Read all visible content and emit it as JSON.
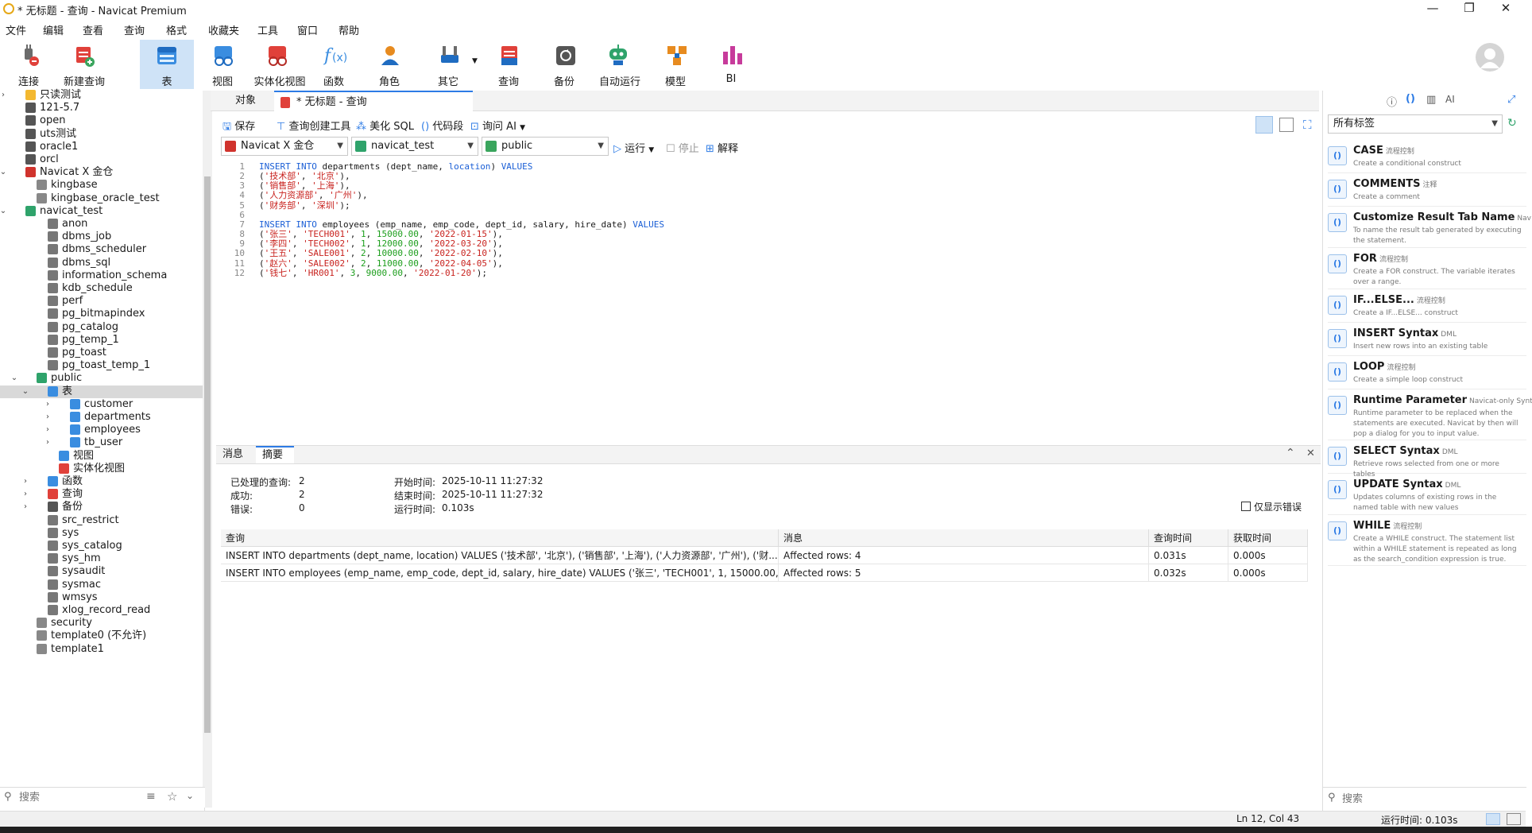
{
  "window": {
    "title": "* 无标题 - 查询 - Navicat Premium",
    "minimize": "—",
    "maximize": "❐",
    "close": "✕"
  },
  "menu": [
    "文件",
    "编辑",
    "查看",
    "查询",
    "格式",
    "收藏夹",
    "工具",
    "窗口",
    "帮助"
  ],
  "toolbar": [
    {
      "label": "连接",
      "icon": "connect-plug-icon"
    },
    {
      "label": "新建查询",
      "icon": "new-query-icon"
    },
    {
      "label": "表",
      "icon": "table-icon"
    },
    {
      "label": "视图",
      "icon": "view-icon"
    },
    {
      "label": "实体化视图",
      "icon": "materialized-view-icon"
    },
    {
      "label": "函数",
      "icon": "function-icon"
    },
    {
      "label": "角色",
      "icon": "role-icon"
    },
    {
      "label": "其它",
      "icon": "other-tools-icon"
    },
    {
      "label": "查询",
      "icon": "query-icon"
    },
    {
      "label": "备份",
      "icon": "backup-icon"
    },
    {
      "label": "自动运行",
      "icon": "automation-robot-icon"
    },
    {
      "label": "模型",
      "icon": "model-icon"
    },
    {
      "label": "BI",
      "icon": "bi-chart-icon"
    }
  ],
  "tree": [
    {
      "label": "只读测试",
      "type": "folder"
    },
    {
      "label": "121-5.7",
      "type": "conn"
    },
    {
      "label": "open",
      "type": "conn"
    },
    {
      "label": "uts测试",
      "type": "conn"
    },
    {
      "label": "oracle1",
      "type": "conn"
    },
    {
      "label": "orcl",
      "type": "conn"
    },
    {
      "label": "Navicat X 金仓",
      "type": "kingbase"
    },
    {
      "label": "kingbase",
      "type": "db"
    },
    {
      "label": "kingbase_oracle_test",
      "type": "db"
    },
    {
      "label": "navicat_test",
      "type": "dbopen"
    },
    {
      "label": "anon",
      "type": "schema"
    },
    {
      "label": "dbms_job",
      "type": "schema"
    },
    {
      "label": "dbms_scheduler",
      "type": "schema"
    },
    {
      "label": "dbms_sql",
      "type": "schema"
    },
    {
      "label": "information_schema",
      "type": "schema"
    },
    {
      "label": "kdb_schedule",
      "type": "schema"
    },
    {
      "label": "perf",
      "type": "schema"
    },
    {
      "label": "pg_bitmapindex",
      "type": "schema"
    },
    {
      "label": "pg_catalog",
      "type": "schema"
    },
    {
      "label": "pg_temp_1",
      "type": "schema"
    },
    {
      "label": "pg_toast",
      "type": "schema"
    },
    {
      "label": "pg_toast_temp_1",
      "type": "schema"
    },
    {
      "label": "public",
      "type": "schemaopen"
    },
    {
      "label": "表",
      "type": "tables"
    },
    {
      "label": "customer",
      "type": "table"
    },
    {
      "label": "departments",
      "type": "table"
    },
    {
      "label": "employees",
      "type": "table"
    },
    {
      "label": "tb_user",
      "type": "table"
    },
    {
      "label": "视图",
      "type": "views"
    },
    {
      "label": "实体化视图",
      "type": "mviews"
    },
    {
      "label": "函数",
      "type": "funcs"
    },
    {
      "label": "查询",
      "type": "queries"
    },
    {
      "label": "备份",
      "type": "backups"
    },
    {
      "label": "src_restrict",
      "type": "schema"
    },
    {
      "label": "sys",
      "type": "schema"
    },
    {
      "label": "sys_catalog",
      "type": "schema"
    },
    {
      "label": "sys_hm",
      "type": "schema"
    },
    {
      "label": "sysaudit",
      "type": "schema"
    },
    {
      "label": "sysmac",
      "type": "schema"
    },
    {
      "label": "wmsys",
      "type": "schema"
    },
    {
      "label": "xlog_record_read",
      "type": "schema"
    },
    {
      "label": "security",
      "type": "db"
    },
    {
      "label": "template0 (不允许)",
      "type": "db"
    },
    {
      "label": "template1",
      "type": "db"
    }
  ],
  "left_search": {
    "placeholder": "搜索"
  },
  "tabs": {
    "objects": "对象",
    "query": "* 无标题 - 查询"
  },
  "editor_toolbar": {
    "save": "保存",
    "query_builder": "查询创建工具",
    "beautify": "美化 SQL",
    "snippets": "代码段",
    "ask_ai": "询问 AI"
  },
  "selectors": {
    "connection": "Navicat X 金仓",
    "database": "navicat_test",
    "schema": "public"
  },
  "run_controls": {
    "run": "运行",
    "stop": "停止",
    "explain": "解释"
  },
  "editor": {
    "line_numbers": [
      "1",
      "2",
      "3",
      "4",
      "5",
      "6",
      "7",
      "8",
      "9",
      "10",
      "11",
      "12"
    ],
    "lines": [
      "INSERT INTO departments (dept_name, location) VALUES",
      "('技术部', '北京'),",
      "('销售部', '上海'),",
      "('人力资源部', '广州'),",
      "('财务部', '深圳');",
      "",
      "INSERT INTO employees (emp_name, emp_code, dept_id, salary, hire_date) VALUES",
      "('张三', 'TECH001', 1, 15000.00, '2022-01-15'),",
      "('李四', 'TECH002', 1, 12000.00, '2022-03-20'),",
      "('王五', 'SALE001', 2, 10000.00, '2022-02-10'),",
      "('赵六', 'SALE002', 2, 11000.00, '2022-04-05'),",
      "('钱七', 'HR001', 3, 9000.00, '2022-01-20');"
    ]
  },
  "result_tabs": {
    "messages": "消息",
    "summary": "摘要"
  },
  "summary": {
    "processed_label": "已处理的查询:",
    "processed": "2",
    "success_label": "成功:",
    "success": "2",
    "errors_label": "错误:",
    "errors": "0",
    "start_label": "开始时间:",
    "start": "2025-10-11 11:27:32",
    "end_label": "结束时间:",
    "end": "2025-10-11 11:27:32",
    "elapsed_label": "运行时间:",
    "elapsed": "0.103s",
    "errors_only": "仅显示错误"
  },
  "result_table": {
    "headers": [
      "查询",
      "消息",
      "查询时间",
      "获取时间"
    ],
    "rows": [
      [
        "INSERT INTO departments (dept_name, location) VALUES ('技术部', '北京'), ('销售部', '上海'), ('人力资源部', '广州'), ('财...",
        "Affected rows: 4",
        "0.031s",
        "0.000s"
      ],
      [
        "INSERT INTO employees (emp_name, emp_code, dept_id, salary, hire_date) VALUES ('张三', 'TECH001', 1, 15000.00,...",
        "Affected rows: 5",
        "0.032s",
        "0.000s"
      ]
    ]
  },
  "right_panel": {
    "filter": "所有标签",
    "search_placeholder": "搜索",
    "snippets": [
      {
        "title": "CASE",
        "tag": "流程控制",
        "desc": "Create a conditional construct"
      },
      {
        "title": "COMMENTS",
        "tag": "注释",
        "desc": "Create a comment"
      },
      {
        "title": "Customize Result Tab Name",
        "tag": "Nav",
        "desc": "To name the result tab generated by executing the statement."
      },
      {
        "title": "FOR",
        "tag": "流程控制",
        "desc": "Create a FOR construct. The variable iterates over a range."
      },
      {
        "title": "IF...ELSE...",
        "tag": "流程控制",
        "desc": "Create a IF...ELSE... construct"
      },
      {
        "title": "INSERT Syntax",
        "tag": "DML",
        "desc": "Insert new rows into an existing table"
      },
      {
        "title": "LOOP",
        "tag": "流程控制",
        "desc": "Create a simple loop construct"
      },
      {
        "title": "Runtime Parameter",
        "tag": "Navicat-only Synt",
        "desc": "Runtime parameter to be replaced when the statements are executed. Navicat by then will pop a dialog for you to input value."
      },
      {
        "title": "SELECT Syntax",
        "tag": "DML",
        "desc": "Retrieve rows selected from one or more tables"
      },
      {
        "title": "UPDATE Syntax",
        "tag": "DML",
        "desc": "Updates columns of existing rows in the named table with new values"
      },
      {
        "title": "WHILE",
        "tag": "流程控制",
        "desc": "Create a WHILE construct. The statement list within a WHILE statement is repeated as long as the search_condition expression is true."
      }
    ]
  },
  "status": {
    "cursor": "Ln 12, Col 43",
    "runtime": "运行时间: 0.103s"
  },
  "colors": {
    "accent": "#2d7be5",
    "keyword": "#1b5fd6",
    "string": "#c8221e",
    "number": "#1c9e1c"
  }
}
